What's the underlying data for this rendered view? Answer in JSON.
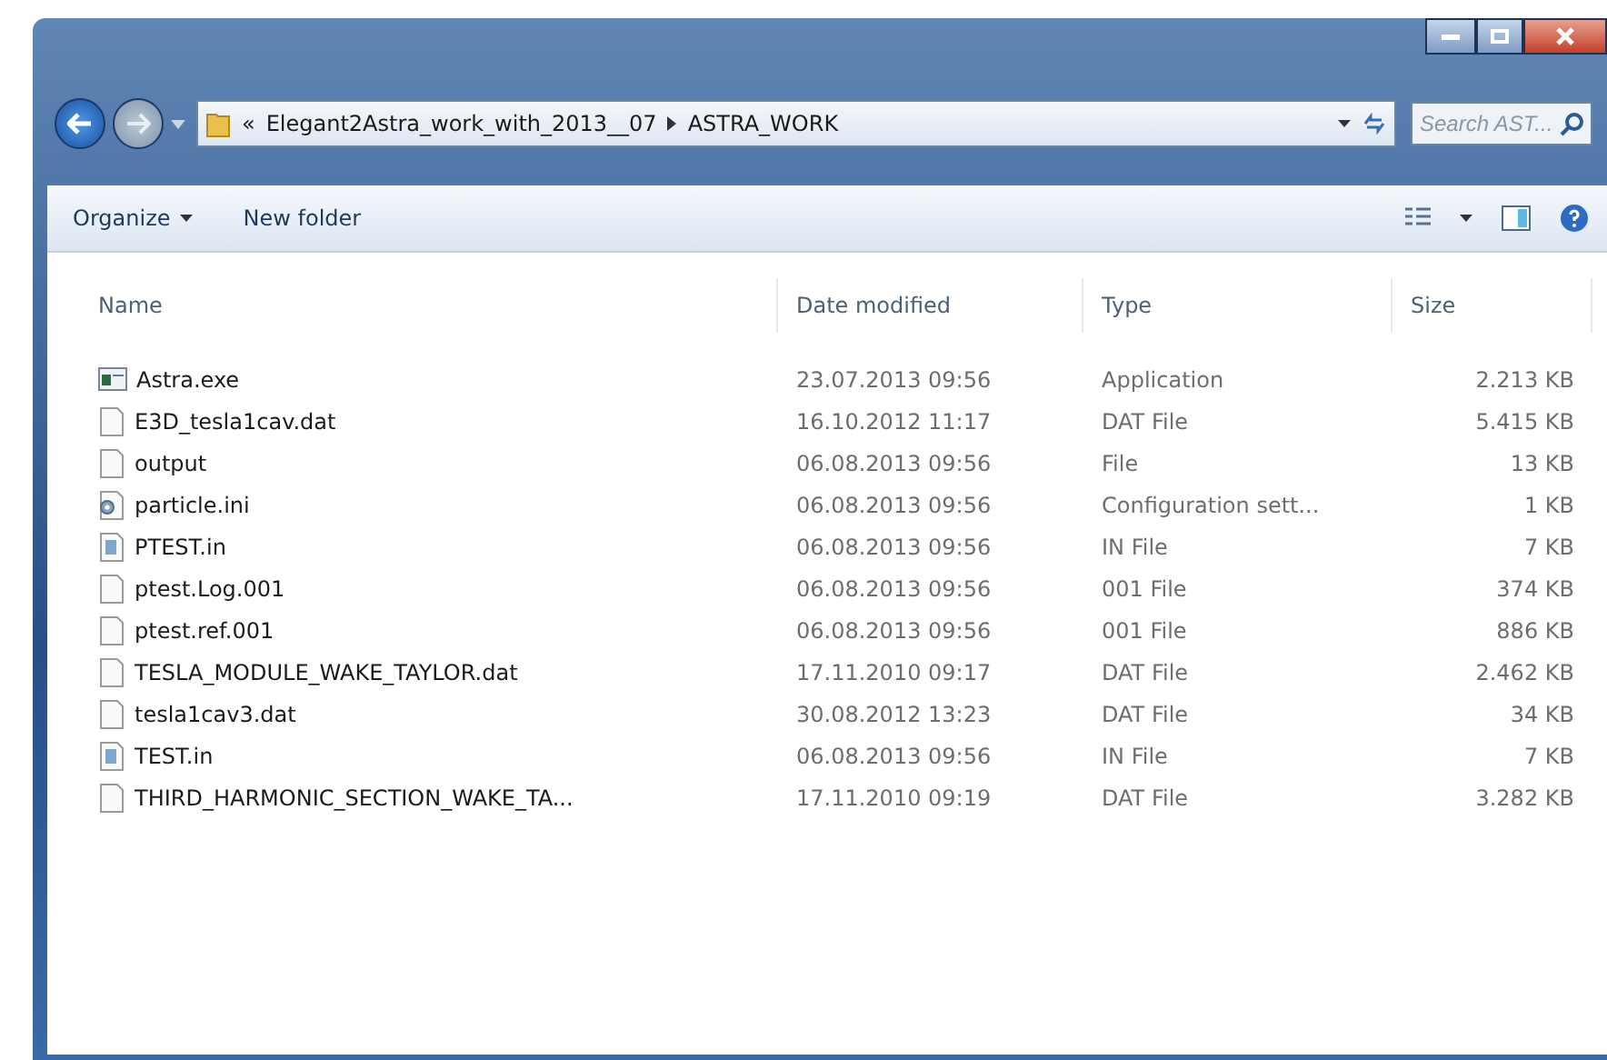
{
  "address_bar": {
    "overflow": "«",
    "path": [
      "Elegant2Astra_work_with_2013__07",
      "ASTRA_WORK"
    ]
  },
  "search": {
    "placeholder": "Search AST..."
  },
  "toolbar": {
    "buttons": [
      {
        "label": "Organize",
        "dropdown": true
      },
      {
        "label": "New folder",
        "dropdown": false
      }
    ]
  },
  "table": {
    "columns": [
      "Name",
      "Date modified",
      "Type",
      "Size"
    ],
    "rows": [
      {
        "kind": "exe",
        "name": "Astra.exe",
        "date": "23.07.2013 09:56",
        "type": "Application",
        "size": "2.213 KB"
      },
      {
        "kind": "blank",
        "name": "E3D_tesla1cav.dat",
        "date": "16.10.2012 11:17",
        "type": "DAT File",
        "size": "5.415 KB"
      },
      {
        "kind": "blank",
        "name": "output",
        "date": "06.08.2013 09:56",
        "type": "File",
        "size": "13 KB"
      },
      {
        "kind": "settings",
        "name": "particle.ini",
        "date": "06.08.2013 09:56",
        "type": "Configuration sett...",
        "size": "1 KB"
      },
      {
        "kind": "text",
        "name": "PTEST.in",
        "date": "06.08.2013 09:56",
        "type": "IN File",
        "size": "7 KB"
      },
      {
        "kind": "blank",
        "name": "ptest.Log.001",
        "date": "06.08.2013 09:56",
        "type": "001 File",
        "size": "374 KB"
      },
      {
        "kind": "blank",
        "name": "ptest.ref.001",
        "date": "06.08.2013 09:56",
        "type": "001 File",
        "size": "886 KB"
      },
      {
        "kind": "blank",
        "name": "TESLA_MODULE_WAKE_TAYLOR.dat",
        "date": "17.11.2010 09:17",
        "type": "DAT File",
        "size": "2.462 KB"
      },
      {
        "kind": "blank",
        "name": "tesla1cav3.dat",
        "date": "30.08.2012 13:23",
        "type": "DAT File",
        "size": "34 KB"
      },
      {
        "kind": "text",
        "name": "TEST.in",
        "date": "06.08.2013 09:56",
        "type": "IN File",
        "size": "7 KB"
      },
      {
        "kind": "blank",
        "name": "THIRD_HARMONIC_SECTION_WAKE_TA...",
        "date": "17.11.2010 09:19",
        "type": "DAT File",
        "size": "3.282 KB"
      }
    ]
  }
}
